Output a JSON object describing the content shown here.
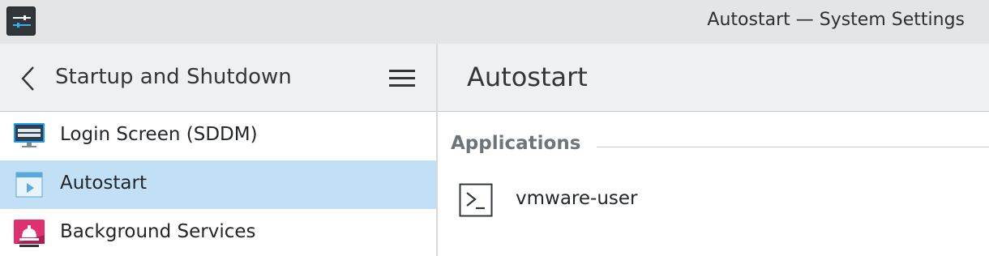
{
  "window": {
    "title": "Autostart — System Settings",
    "app_icon": "system-settings-icon"
  },
  "sidebar": {
    "title": "Startup and Shutdown",
    "back_icon": "chevron-left-icon",
    "menu_icon": "hamburger-menu-icon",
    "items": [
      {
        "label": "Login Screen (SDDM)",
        "icon": "monitor-icon",
        "selected": false
      },
      {
        "label": "Autostart",
        "icon": "autostart-icon",
        "selected": true
      },
      {
        "label": "Background Services",
        "icon": "background-services-icon",
        "selected": false
      }
    ]
  },
  "content": {
    "title": "Autostart",
    "section_heading": "Applications",
    "applications": [
      {
        "name": "vmware-user",
        "icon": "terminal-icon"
      }
    ]
  },
  "colors": {
    "selection": "#c2e0f5",
    "accent": "#3daee9",
    "header_bg": "#eff0f1"
  }
}
